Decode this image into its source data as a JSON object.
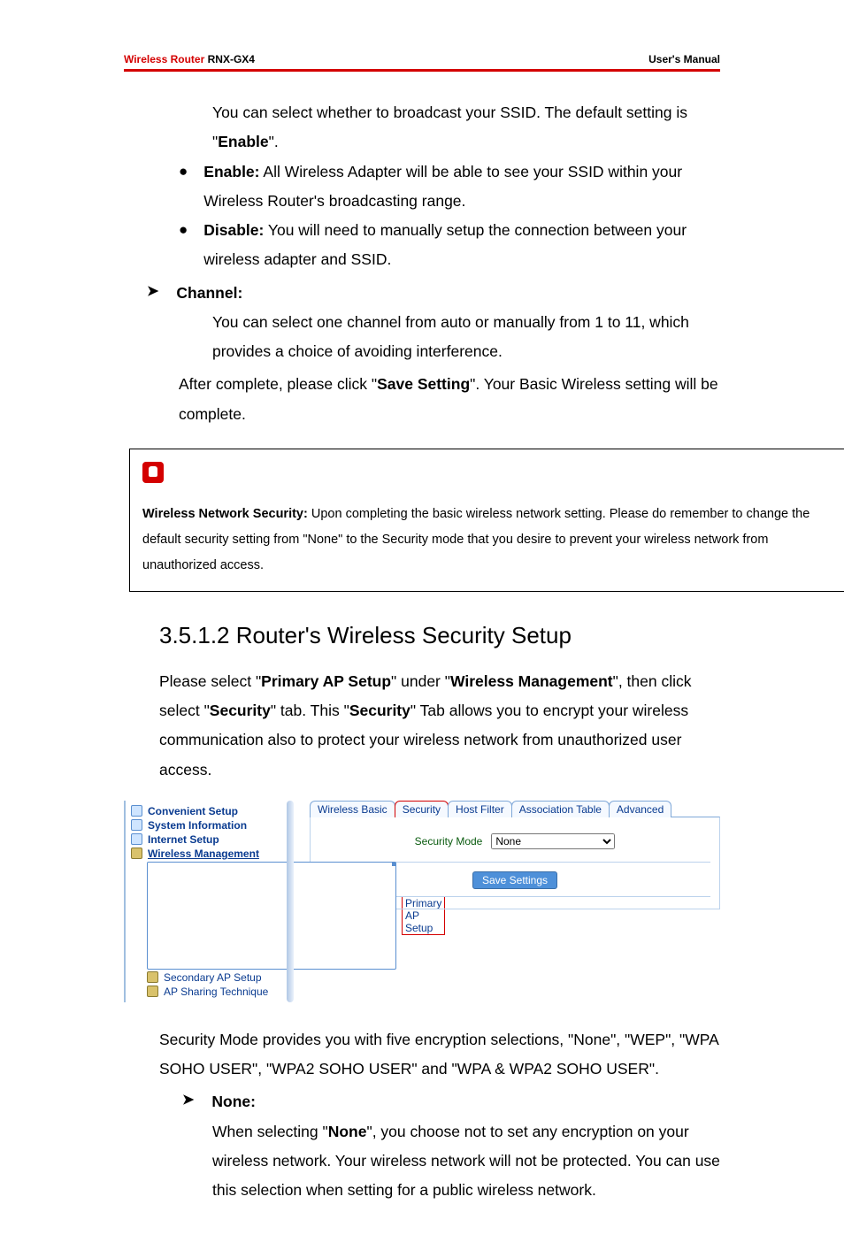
{
  "header": {
    "product_prefix": "Wireless Router",
    "product_model": "RNX-GX4",
    "right": "User's Manual"
  },
  "intro_p1_a": "You can select whether to broadcast your SSID. The default setting is \"",
  "intro_p1_bold": "Enable",
  "intro_p1_b": "\".",
  "enable_label": "Enable:",
  "enable_text": " All Wireless Adapter will be able to see your SSID within your Wireless Router's broadcasting range.",
  "disable_label": "Disable:",
  "disable_text": " You will need to manually setup the connection between your wireless adapter and SSID.",
  "channel_label": "Channel:",
  "channel_text": "You can select one channel from auto or manually from 1 to 11, which provides a choice of avoiding interference.",
  "after_a": "After complete, please click \"",
  "after_bold": "Save Setting",
  "after_b": "\". Your Basic Wireless setting will be complete.",
  "note_bold": "Wireless Network Security:",
  "note_text": " Upon completing the basic wireless network setting. Please do remember to change the default security setting from \"None\" to the Security mode that you desire to prevent your wireless network from unauthorized access.",
  "section_heading": "3.5.1.2 Router's Wireless Security Setup",
  "sec_p_a": "Please select \"",
  "sec_p_b1": "Primary AP Setup",
  "sec_p_c": "\" under \"",
  "sec_p_b2": "Wireless Management",
  "sec_p_d": "\", then click select \"",
  "sec_p_b3": "Security",
  "sec_p_e": "\" tab. This \"",
  "sec_p_b4": "Security",
  "sec_p_f": "\" Tab allows you to encrypt your wireless communication also to protect your wireless network from unauthorized user access.",
  "sidebar": {
    "items": [
      {
        "label": "Convenient Setup"
      },
      {
        "label": "System Information"
      },
      {
        "label": "Internet Setup"
      },
      {
        "label": "Wireless Management"
      },
      {
        "label": "Primary AP Setup"
      },
      {
        "label": "Secondary AP Setup"
      },
      {
        "label": "AP Sharing Technique"
      }
    ]
  },
  "tabs": [
    {
      "label": "Wireless Basic"
    },
    {
      "label": "Security"
    },
    {
      "label": "Host Filter"
    },
    {
      "label": "Association Table"
    },
    {
      "label": "Advanced"
    }
  ],
  "form": {
    "security_mode_label": "Security Mode",
    "security_mode_value": "None",
    "save_button": "Save Settings"
  },
  "modes_text": "Security Mode provides you with five encryption selections, \"None\", \"WEP\", \"WPA SOHO USER\", \"WPA2 SOHO USER\" and \"WPA & WPA2 SOHO USER\".",
  "none_label": "None:",
  "none_a": "When selecting \"",
  "none_bold": "None",
  "none_b": "\", you choose not to set any encryption on your wireless network. Your wireless network will not be protected. You can use this selection when setting for a public wireless network.",
  "chart_data": null
}
